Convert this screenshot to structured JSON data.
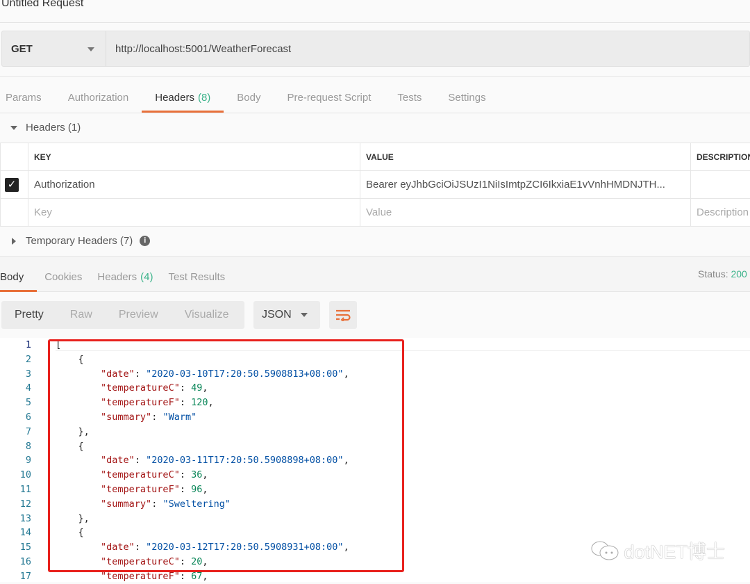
{
  "title": "Untitled Request",
  "request": {
    "method": "GET",
    "url": "http://localhost:5001/WeatherForecast"
  },
  "req_tabs": [
    {
      "label": "Params"
    },
    {
      "label": "Authorization"
    },
    {
      "label": "Headers",
      "count": "(8)"
    },
    {
      "label": "Body"
    },
    {
      "label": "Pre-request Script"
    },
    {
      "label": "Tests"
    },
    {
      "label": "Settings"
    }
  ],
  "headers_section": "Headers (1)",
  "table": {
    "columns": [
      "KEY",
      "VALUE",
      "DESCRIPTION"
    ],
    "row": {
      "checked": true,
      "key": "Authorization",
      "value": "Bearer  eyJhbGciOiJSUzI1NiIsImtpZCI6IkxiaE1vVnhHMDNJTH...",
      "description": ""
    },
    "placeholders": {
      "key": "Key",
      "value": "Value",
      "description": "Description"
    }
  },
  "temp_headers": "Temporary Headers (7)",
  "resp_tabs": [
    {
      "label": "Body"
    },
    {
      "label": "Cookies"
    },
    {
      "label": "Headers",
      "count": "(4)"
    },
    {
      "label": "Test Results"
    }
  ],
  "status": {
    "label": "Status:",
    "value": "200"
  },
  "view_modes": [
    "Pretty",
    "Raw",
    "Preview",
    "Visualize"
  ],
  "format": "JSON",
  "watermark": "dotNET博士",
  "colors": {
    "accent": "#e8703a",
    "green": "#3bb38a",
    "highlight": "#e8211d"
  },
  "code_lines": [
    [
      [
        "p",
        "["
      ]
    ],
    [
      [
        "p",
        "    {"
      ]
    ],
    [
      [
        "p",
        "        "
      ],
      [
        "k",
        "\"date\""
      ],
      [
        "p",
        ": "
      ],
      [
        "s",
        "\"2020-03-10T17:20:50.5908813+08:00\""
      ],
      [
        "p",
        ","
      ]
    ],
    [
      [
        "p",
        "        "
      ],
      [
        "k",
        "\"temperatureC\""
      ],
      [
        "p",
        ": "
      ],
      [
        "n",
        "49"
      ],
      [
        "p",
        ","
      ]
    ],
    [
      [
        "p",
        "        "
      ],
      [
        "k",
        "\"temperatureF\""
      ],
      [
        "p",
        ": "
      ],
      [
        "n",
        "120"
      ],
      [
        "p",
        ","
      ]
    ],
    [
      [
        "p",
        "        "
      ],
      [
        "k",
        "\"summary\""
      ],
      [
        "p",
        ": "
      ],
      [
        "s",
        "\"Warm\""
      ]
    ],
    [
      [
        "p",
        "    },"
      ]
    ],
    [
      [
        "p",
        "    {"
      ]
    ],
    [
      [
        "p",
        "        "
      ],
      [
        "k",
        "\"date\""
      ],
      [
        "p",
        ": "
      ],
      [
        "s",
        "\"2020-03-11T17:20:50.5908898+08:00\""
      ],
      [
        "p",
        ","
      ]
    ],
    [
      [
        "p",
        "        "
      ],
      [
        "k",
        "\"temperatureC\""
      ],
      [
        "p",
        ": "
      ],
      [
        "n",
        "36"
      ],
      [
        "p",
        ","
      ]
    ],
    [
      [
        "p",
        "        "
      ],
      [
        "k",
        "\"temperatureF\""
      ],
      [
        "p",
        ": "
      ],
      [
        "n",
        "96"
      ],
      [
        "p",
        ","
      ]
    ],
    [
      [
        "p",
        "        "
      ],
      [
        "k",
        "\"summary\""
      ],
      [
        "p",
        ": "
      ],
      [
        "s",
        "\"Sweltering\""
      ]
    ],
    [
      [
        "p",
        "    },"
      ]
    ],
    [
      [
        "p",
        "    {"
      ]
    ],
    [
      [
        "p",
        "        "
      ],
      [
        "k",
        "\"date\""
      ],
      [
        "p",
        ": "
      ],
      [
        "s",
        "\"2020-03-12T17:20:50.5908931+08:00\""
      ],
      [
        "p",
        ","
      ]
    ],
    [
      [
        "p",
        "        "
      ],
      [
        "k",
        "\"temperatureC\""
      ],
      [
        "p",
        ": "
      ],
      [
        "n",
        "20"
      ],
      [
        "p",
        ","
      ]
    ],
    [
      [
        "p",
        "        "
      ],
      [
        "k",
        "\"temperatureF\""
      ],
      [
        "p",
        ": "
      ],
      [
        "n",
        "67"
      ],
      [
        "p",
        ","
      ]
    ]
  ]
}
